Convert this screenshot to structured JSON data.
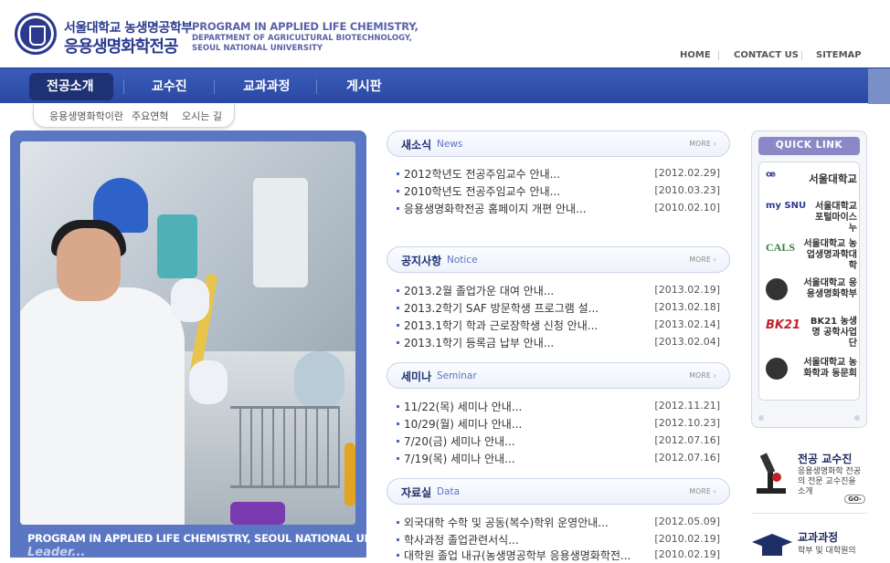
{
  "header": {
    "kor_line1": "서울대학교 농생명공학부",
    "kor_line2": "응용생명화학전공",
    "eng_line1": "PROGRAM IN APPLIED LIFE CHEMISTRY,",
    "eng_line2": "DEPARTMENT OF AGRICULTURAL BIOTECHNOLOGY,",
    "eng_line3": "SEOUL NATIONAL UNIVERSITY",
    "util_links": [
      "HOME",
      "CONTACT US",
      "SITEMAP"
    ]
  },
  "nav": {
    "items": [
      "전공소개",
      "교수진",
      "교과과정",
      "게시판"
    ],
    "active": "전공소개",
    "sub_items": [
      "응용생명화학이란",
      "주요연혁",
      "오시는 길"
    ]
  },
  "photo": {
    "caption_line1": "PROGRAM IN APPLIED LIFE CHEMISTRY, SEOUL NATIONAL UNIVERSITY",
    "caption_line2": "Leader..."
  },
  "boards": [
    {
      "title": "새소식",
      "subtitle": "News",
      "more": "MORE ›",
      "posts": [
        {
          "title": "2012학년도 전공주임교수 안내...",
          "date": "[2012.02.29]"
        },
        {
          "title": "2010학년도 전공주임교수 안내...",
          "date": "[2010.03.23]"
        },
        {
          "title": "응용생명화학전공 홈페이지 개편 안내...",
          "date": "[2010.02.10]"
        }
      ]
    },
    {
      "title": "공지사항",
      "subtitle": "Notice",
      "more": "MORE ›",
      "posts": [
        {
          "title": "2013.2월 졸업가운 대여 안내...",
          "date": "[2013.02.19]"
        },
        {
          "title": "2013.2학기 SAF 방문학생 프로그램 설...",
          "date": "[2013.02.18]"
        },
        {
          "title": "2013.1학기 학과 근로장학생 신청 안내...",
          "date": "[2013.02.14]"
        },
        {
          "title": "2013.1학기 등록금 납부 안내...",
          "date": "[2013.02.04]"
        }
      ]
    },
    {
      "title": "세미나",
      "subtitle": "Seminar",
      "more": "MORE ›",
      "posts": [
        {
          "title": "11/22(목) 세미나 안내...",
          "date": "[2012.11.21]"
        },
        {
          "title": "10/29(월) 세미나 안내...",
          "date": "[2012.10.23]"
        },
        {
          "title": "7/20(금) 세미나 안내...",
          "date": "[2012.07.16]"
        },
        {
          "title": "7/19(목) 세미나 안내...",
          "date": "[2012.07.16]"
        }
      ]
    },
    {
      "title": "자료실",
      "subtitle": "Data",
      "more": "MORE ›",
      "posts": [
        {
          "title": "외국대학 수학 및 공동(복수)학위 운영안내...",
          "date": "[2012.05.09]"
        },
        {
          "title": "학사과정 졸업관련서식...",
          "date": "[2010.02.19]"
        },
        {
          "title": "대학원 졸업 내규(농생명공학부 응용생명화학전...",
          "date": "[2010.02.19]"
        }
      ]
    }
  ],
  "quick_link": {
    "title": "QUICK LINK",
    "items": [
      {
        "logo": "S",
        "label": "서울대학교",
        "color": "#2b3a8f"
      },
      {
        "logo": "my SNU",
        "label": "서울대학교 포털마이스누",
        "color": "#2b3a8f"
      },
      {
        "logo": "CALS",
        "label": "서울대학교 농업생명과학대학",
        "color": "#3a7a3a"
      },
      {
        "logo": "seal",
        "label": "서울대학교 응용생명화학부",
        "color": "#333333"
      },
      {
        "logo": "BK21",
        "label": "BK21 농생명 공학사업단",
        "color": "#c0242a"
      },
      {
        "logo": "seal",
        "label": "서울대학교 농화학과 동문회",
        "color": "#333333"
      }
    ]
  },
  "promos": [
    {
      "title": "전공 교수진",
      "text": "응용생명화학 전공의 전문 교수진을 소개",
      "button": "GO›"
    },
    {
      "title": "교과과정",
      "text": "학부 및 대학원의"
    }
  ]
}
